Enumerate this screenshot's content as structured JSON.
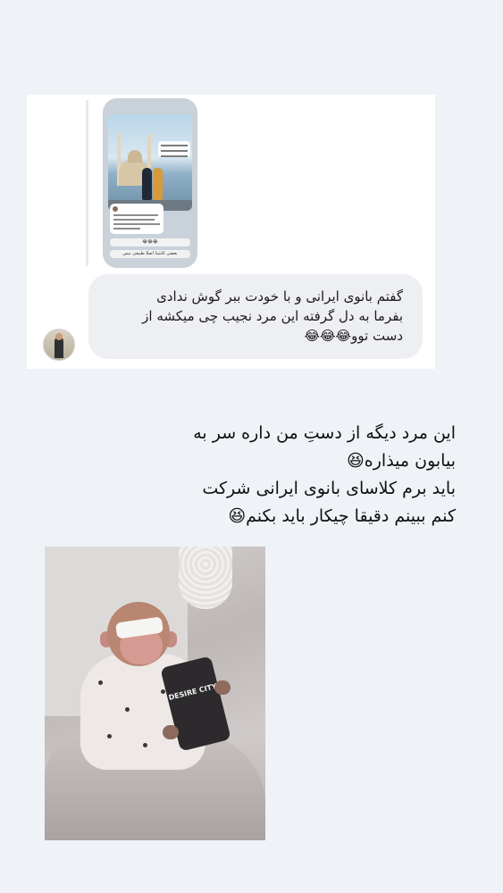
{
  "chat": {
    "story_preview": {
      "caption_line": "بعضی کاشتا اصلا طبیعی نیس",
      "reactions_line": "😂😂😂"
    },
    "reply_text": "گفتم بانوی ایرانی و با خودت ببر گوش ندادی\nبفرما  به دل گرفته این مرد نجیب چی میکشه از\nدست توو😂😂😂"
  },
  "caption": "این مرد دیگه از دستِ من داره سر به\nبیابون میذاره😆\nباید برم کلاسای بانوی ایرانی شرکت\nکنم ببینم دقیقا چیکار باید بکنم😆",
  "photo": {
    "phone_case_text": "DESIRE CITY"
  },
  "colors": {
    "background": "#eff2f7",
    "reply_bubble": "#eeeff3",
    "card": "#ffffff"
  }
}
